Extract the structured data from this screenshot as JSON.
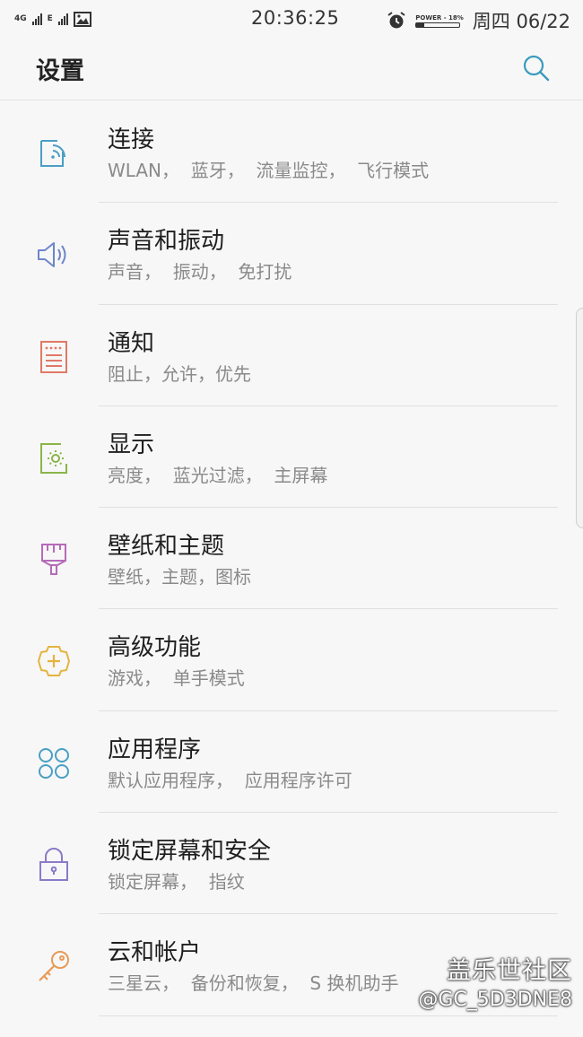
{
  "status_bar": {
    "net1": "4G",
    "net2": "E",
    "time": "20:36:25",
    "battery_label": "POWER - 18%",
    "battery_level": 0.18,
    "date": "周四 06/22"
  },
  "app_bar": {
    "title": "设置",
    "search_icon": "search-icon"
  },
  "items": [
    {
      "title": "连接",
      "sub": "WLAN，  蓝牙，  流量监控，  飞行模式",
      "icon": "connections-icon",
      "color": "#4a9fc4"
    },
    {
      "title": "声音和振动",
      "sub": "声音，  振动，  免打扰",
      "icon": "speaker-icon",
      "color": "#6e86c9"
    },
    {
      "title": "通知",
      "sub": "阻止，允许，优先",
      "icon": "notifications-icon",
      "color": "#e07a66"
    },
    {
      "title": "显示",
      "sub": "亮度，  蓝光过滤，  主屏幕",
      "icon": "display-icon",
      "color": "#8bb54a"
    },
    {
      "title": "壁纸和主题",
      "sub": "壁纸，主题，图标",
      "icon": "paintbrush-icon",
      "color": "#b56bb8"
    },
    {
      "title": "高级功能",
      "sub": "游戏，  单手模式",
      "icon": "advanced-features-icon",
      "color": "#e3b43f"
    },
    {
      "title": "应用程序",
      "sub": "默认应用程序，  应用程序许可",
      "icon": "apps-icon",
      "color": "#4a9fc4"
    },
    {
      "title": "锁定屏幕和安全",
      "sub": "锁定屏幕，  指纹",
      "icon": "lock-icon",
      "color": "#8b7ac9"
    },
    {
      "title": "云和帐户",
      "sub": "三星云，  备份和恢复，  S 换机助手",
      "icon": "key-icon",
      "color": "#e89a56"
    }
  ],
  "watermark": {
    "line1": "盖乐世社区",
    "line2": "@GC_5D3DNE8"
  }
}
